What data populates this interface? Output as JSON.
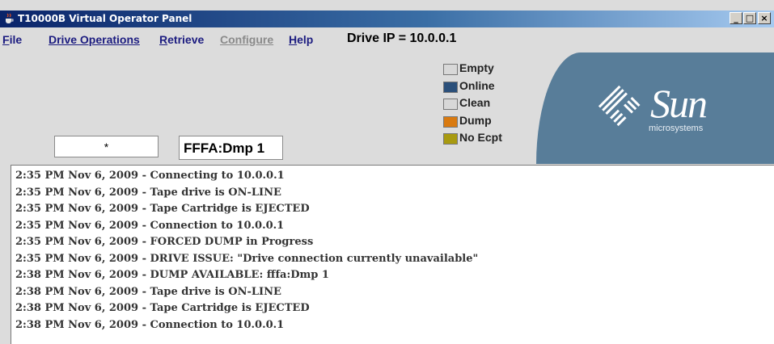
{
  "window": {
    "title": "T10000B Virtual Operator Panel",
    "controls": {
      "minimize": "_",
      "maximize": "□",
      "close": "×"
    }
  },
  "menu": {
    "items": [
      {
        "underline": "F",
        "rest": "ile",
        "enabled": true
      },
      {
        "underline": "",
        "rest": "Drive Operations",
        "enabled": true
      },
      {
        "underline": "R",
        "rest": "etrieve",
        "enabled": true
      },
      {
        "underline": "",
        "rest": "Configure",
        "enabled": false
      },
      {
        "underline": "H",
        "rest": "elp",
        "enabled": true
      }
    ],
    "drive_ip": "Drive IP = 10.0.0.1"
  },
  "fields": {
    "field1": "*",
    "field2": "FFFA:Dmp 1"
  },
  "legend": [
    {
      "label": "Empty",
      "color": "#d8d8d8"
    },
    {
      "label": "Online",
      "color": "#2a4f7a"
    },
    {
      "label": "Clean",
      "color": "#d8d8d8"
    },
    {
      "label": "Dump",
      "color": "#d97a10"
    },
    {
      "label": "No Ecpt",
      "color": "#a89a10"
    }
  ],
  "brand": {
    "name": "Sun",
    "sub": "microsystems",
    "panel_color": "#587d99"
  },
  "log": [
    "2:35 PM Nov 6, 2009 - Connecting to 10.0.0.1",
    "2:35 PM Nov 6, 2009 - Tape drive is ON-LINE",
    "2:35 PM Nov 6, 2009 - Tape Cartridge is EJECTED",
    "2:35 PM Nov 6, 2009 - Connection to 10.0.0.1",
    "2:35 PM Nov 6, 2009 - FORCED DUMP in Progress",
    "2:35 PM Nov 6, 2009 - DRIVE ISSUE: \"Drive connection currently unavailable\"",
    "2:38 PM Nov 6, 2009 - DUMP AVAILABLE: fffa:Dmp 1",
    "2:38 PM Nov 6, 2009 - Tape drive is ON-LINE",
    "2:38 PM Nov 6, 2009 - Tape Cartridge is EJECTED",
    "2:38 PM Nov 6, 2009 - Connection to 10.0.0.1"
  ]
}
